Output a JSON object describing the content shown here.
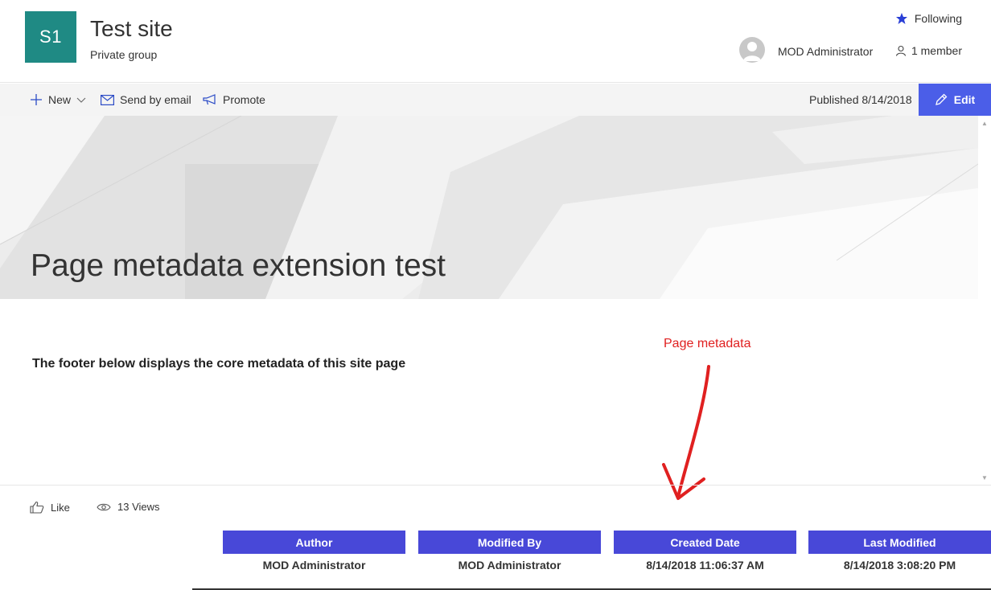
{
  "header": {
    "logo_text": "S1",
    "site_title": "Test site",
    "site_subtitle": "Private group",
    "following_label": "Following",
    "owner_name": "MOD Administrator",
    "members_label": "1 member"
  },
  "commandbar": {
    "new_label": "New",
    "email_label": "Send by email",
    "promote_label": "Promote",
    "published_text": "Published 8/14/2018",
    "edit_label": "Edit"
  },
  "hero": {
    "title": "Page metadata extension test"
  },
  "content": {
    "text": "The footer below displays the core metadata of this site page",
    "annotation": "Page metadata"
  },
  "social": {
    "like_label": "Like",
    "views_label": "13 Views"
  },
  "metadata": {
    "author": {
      "header": "Author",
      "value": "MOD Administrator"
    },
    "modified_by": {
      "header": "Modified By",
      "value": "MOD Administrator"
    },
    "created": {
      "header": "Created Date",
      "value": "8/14/2018 11:06:37 AM"
    },
    "last_modified": {
      "header": "Last Modified",
      "value": "8/14/2018 3:08:20 PM"
    }
  },
  "colors": {
    "logo_bg": "#1f8a84",
    "edit_button": "#4b5ee8",
    "metadata_header": "#4848d8",
    "annotation": "#e02020",
    "following_star": "#2a3fd6"
  },
  "icons": [
    "star-icon",
    "person-icon",
    "plus-icon",
    "chevron-down-icon",
    "mail-icon",
    "megaphone-icon",
    "pencil-icon",
    "like-icon",
    "eye-icon"
  ]
}
